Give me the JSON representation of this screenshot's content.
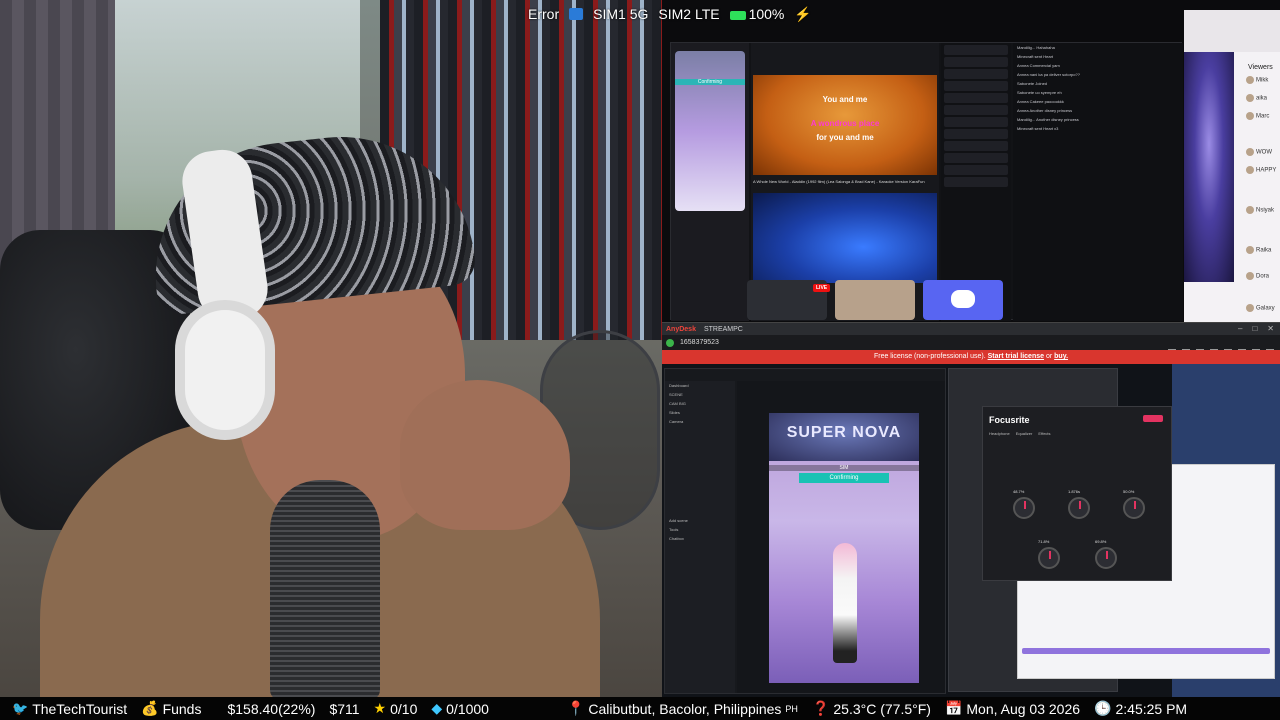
{
  "status_bar": {
    "error": "Error",
    "sim1": "SIM1 5G",
    "sim2": "SIM2 LTE",
    "battery": "100%"
  },
  "pc_screen": {
    "karaoke": {
      "lyric1": "You and me",
      "lyric2": "A wondrous place",
      "lyric3": "for you and me",
      "song_title": "A Whole New World - Aladdin (1992 film) (Lea Salonga & Brad Kane) - Karaoke Version KaraFun"
    },
    "tiktok_label": "Confirming",
    "live_badge": "LIVE",
    "chat_lines": [
      "Mandilig... Hahahaha",
      "Minecraft sent Heart",
      "Annea Commercial yarn",
      "Annea nani ka pa deliver sotorpo??",
      "Sabonete Joined",
      "Sabonete uo syempre eh",
      "Annea Cakeee paooookkk",
      "Annea Another disney princess",
      "Mandilig... Another disney princess",
      "Minecraft sent Heart x3"
    ],
    "viewers": {
      "label": "Viewers",
      "list": [
        "Mikk",
        "aika",
        "Marc",
        "WOW",
        "HAPPY",
        "Nsiyak",
        "Raika",
        "Dora",
        "Galaxy"
      ]
    }
  },
  "anydesk": {
    "app_name": "AnyDesk",
    "tab": "STREAMPC",
    "address": "1658379523",
    "banner_prefix": "Free license (non-professional use).",
    "banner_link1": "Start trial license",
    "banner_middle": "or",
    "banner_link2": "buy.",
    "stage_banner": "SUPER NOVA",
    "stage_sim": "SIM",
    "stage_confirm": "Confirming",
    "sidebar_items": [
      "Dashboard",
      "SCENE",
      "CAM BIG",
      "Slides",
      "Camera",
      "Add scene",
      "Tools",
      "Chatbox"
    ],
    "focusrite": {
      "title": "Focusrite",
      "tabs": [
        "Headphone",
        "Equalizer",
        "Effects"
      ],
      "knob_values": [
        "48.7%",
        "1.876s",
        "50.0%",
        "71.8%",
        "69.8%"
      ]
    }
  },
  "ticker": {
    "channel": "TheTechTourist",
    "funds_label": "Funds",
    "funds_value": "$158.40(22%)",
    "amount": "$711",
    "stars": "0/10",
    "gems": "0/1000",
    "location": "Calibutbut, Bacolor, Philippines",
    "location_code": "PH",
    "temperature": "25.3°C (77.5°F)",
    "date": "Mon, Aug 03 2026",
    "time": "2:45:25 PM"
  }
}
